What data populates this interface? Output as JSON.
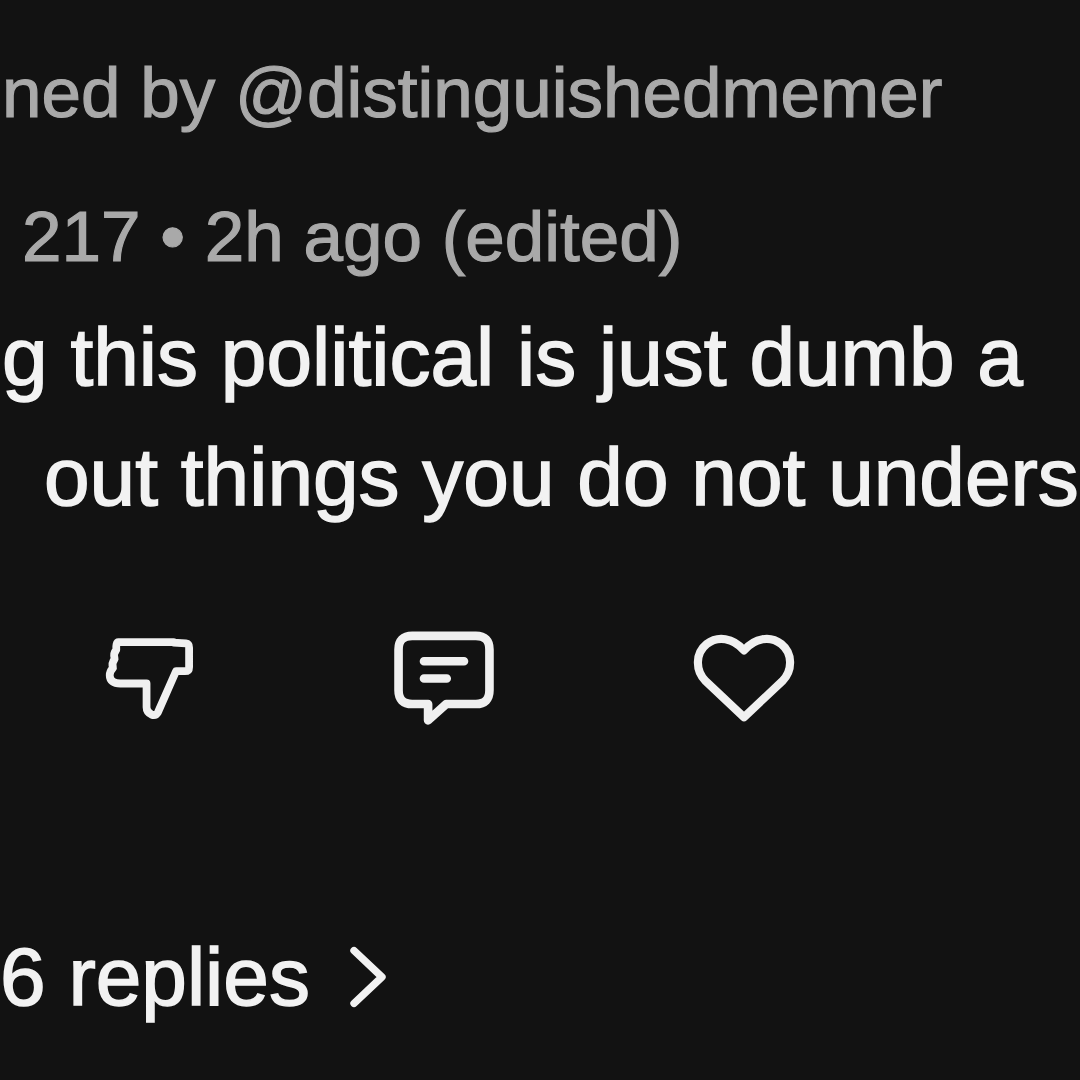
{
  "pinned_by": "ned by @distinguishedmemer",
  "comment": {
    "meta": "217 • 2h ago (edited)",
    "lines": [
      "g this political is just dumb a",
      "out things you do not unders"
    ]
  },
  "actions": [
    {
      "kind": "dislike",
      "active": false
    },
    {
      "kind": "reply",
      "active": false
    },
    {
      "kind": "like",
      "active": false
    }
  ],
  "replies_link": {
    "label": "6 replies"
  }
}
